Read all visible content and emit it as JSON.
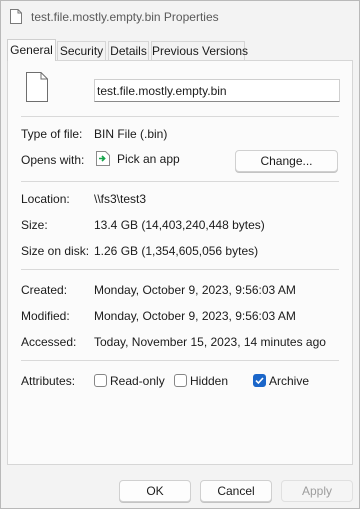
{
  "window": {
    "title": "test.file.mostly.empty.bin Properties"
  },
  "tabs": [
    {
      "label": "General",
      "active": true
    },
    {
      "label": "Security",
      "active": false
    },
    {
      "label": "Details",
      "active": false
    },
    {
      "label": "Previous Versions",
      "active": false
    }
  ],
  "general": {
    "file_name": "test.file.mostly.empty.bin",
    "type_of_file": {
      "label": "Type of file:",
      "value": "BIN File (.bin)"
    },
    "opens_with": {
      "label": "Opens with:",
      "value": "Pick an app",
      "button": "Change..."
    },
    "location": {
      "label": "Location:",
      "value": "\\\\fs3\\test3"
    },
    "size": {
      "label": "Size:",
      "value": "13.4 GB (14,403,240,448 bytes)"
    },
    "size_on_disk": {
      "label": "Size on disk:",
      "value": "1.26 GB (1,354,605,056 bytes)"
    },
    "created": {
      "label": "Created:",
      "value": "Monday, October 9, 2023, 9:56:03 AM"
    },
    "modified": {
      "label": "Modified:",
      "value": "Monday, October 9, 2023, 9:56:03 AM"
    },
    "accessed": {
      "label": "Accessed:",
      "value": "Today, November 15, 2023, 14 minutes ago"
    },
    "attributes": {
      "label": "Attributes:",
      "read_only": {
        "label": "Read-only",
        "checked": false
      },
      "hidden": {
        "label": "Hidden",
        "checked": false
      },
      "archive": {
        "label": "Archive",
        "checked": true
      }
    }
  },
  "footer": {
    "ok": "OK",
    "cancel": "Cancel",
    "apply": "Apply"
  },
  "colors": {
    "accent": "#1b66c9",
    "background": "#f3f3f3",
    "panel": "#fbfbfb"
  }
}
